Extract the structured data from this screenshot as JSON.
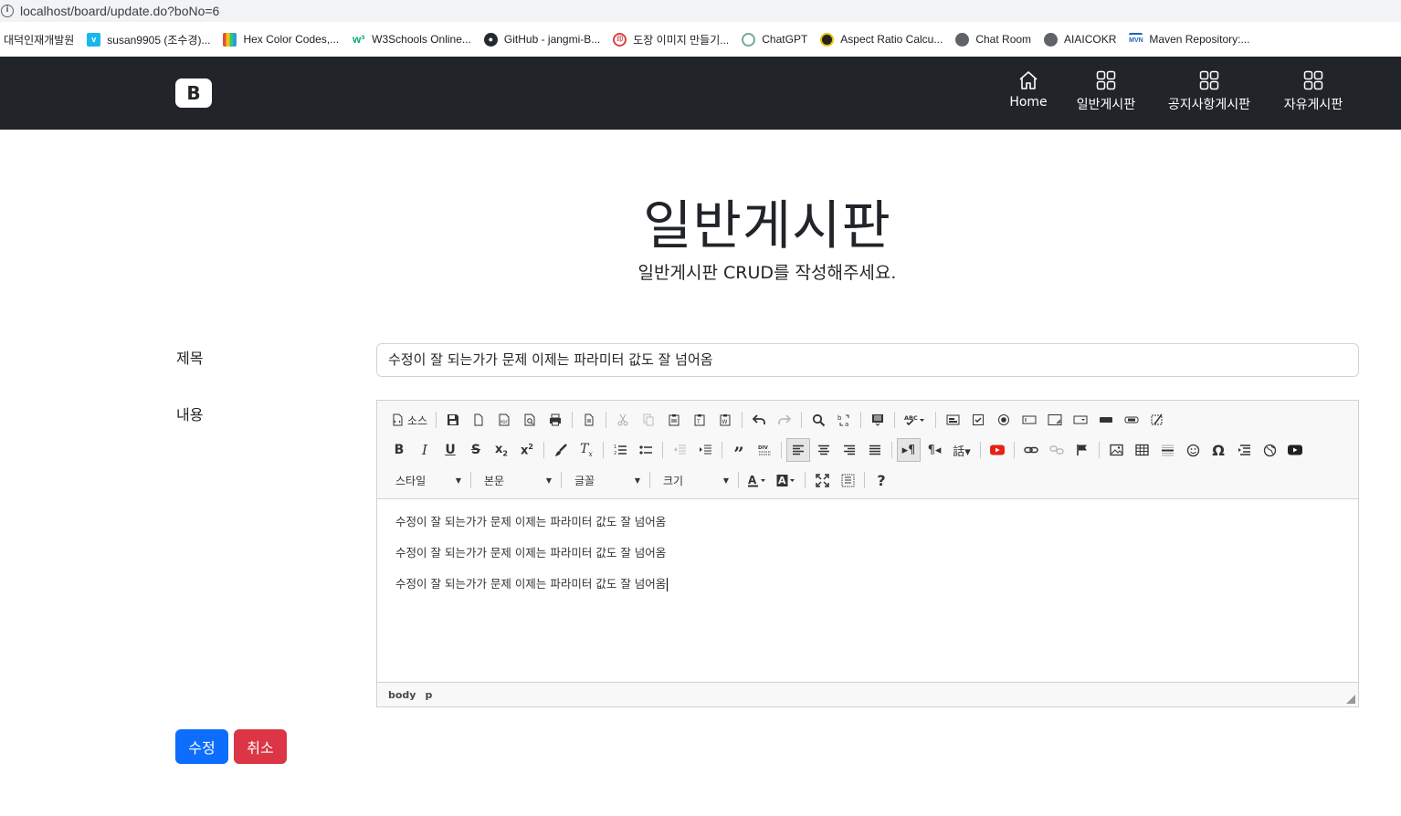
{
  "browser": {
    "url": "localhost/board/update.do?boNo=6",
    "bookmarks": [
      {
        "label": "대덕인재개발원",
        "icon": "none",
        "color": ""
      },
      {
        "label": "susan9905 (조수경)...",
        "icon": "v-icon",
        "color": "#1ab7ea"
      },
      {
        "label": "Hex Color Codes,...",
        "icon": "color-book-icon",
        "color": "#8e44ad"
      },
      {
        "label": "W3Schools Online...",
        "icon": "w3schools-icon",
        "color": "#04aa6d"
      },
      {
        "label": "GitHub - jangmi-B...",
        "icon": "github-icon",
        "color": "#24292f"
      },
      {
        "label": "도장 이미지 만들기...",
        "icon": "stamp-icon",
        "color": "#d64545"
      },
      {
        "label": "ChatGPT",
        "icon": "chatgpt-icon",
        "color": "#74aa9c"
      },
      {
        "label": "Aspect Ratio Calcu...",
        "icon": "aspect-icon",
        "color": "#e6c200"
      },
      {
        "label": "Chat Room",
        "icon": "globe-icon",
        "color": "#5f6368"
      },
      {
        "label": "AIAICOKR",
        "icon": "globe-icon",
        "color": "#5f6368"
      },
      {
        "label": "Maven Repository:...",
        "icon": "maven-icon",
        "color": "#1e63b6"
      }
    ]
  },
  "navbar": {
    "logo": "B",
    "items": [
      {
        "label": "Home",
        "icon": "house-icon"
      },
      {
        "label": "일반게시판",
        "icon": "grid-icon"
      },
      {
        "label": "공지사항게시판",
        "icon": "grid-icon"
      },
      {
        "label": "자유게시판",
        "icon": "grid-icon"
      }
    ]
  },
  "header": {
    "title": "일반게시판",
    "subtitle": "일반게시판 CRUD를 작성해주세요."
  },
  "form": {
    "title_label": "제목",
    "title_value": "수정이 잘 되는가가 문제 이제는 파라미터 값도 잘 넘어옴",
    "content_label": "내용",
    "editor": {
      "source_label": "소스",
      "combos": {
        "style": "스타일",
        "format": "본문",
        "font": "글꼴",
        "size": "크기"
      },
      "help": "?",
      "paragraphs": [
        "수정이 잘 되는가가 문제 이제는 파라미터 값도 잘 넘어옴",
        "수정이 잘 되는가가 문제 이제는 파라미터 값도 잘 넘어옴",
        "수정이 잘 되는가가 문제 이제는 파라미터 값도 잘 넘어옴"
      ],
      "path": [
        "body",
        "p"
      ]
    },
    "submit_label": "수정",
    "cancel_label": "취소"
  },
  "colors": {
    "navbar": "#212529",
    "primary": "#0d6efd",
    "danger": "#dc3545"
  }
}
